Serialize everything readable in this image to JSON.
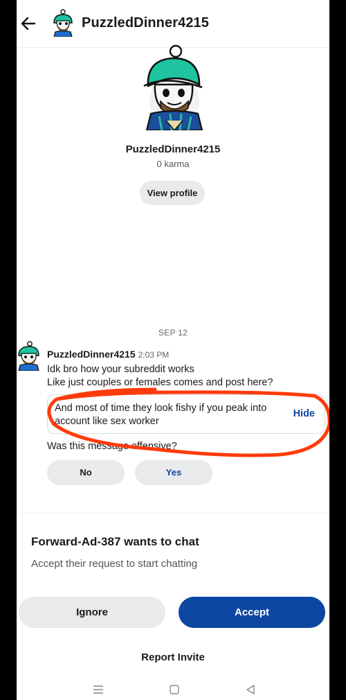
{
  "header": {
    "title": "PuzzledDinner4215"
  },
  "profile": {
    "name": "PuzzledDinner4215",
    "karma": "0 karma",
    "view_profile_label": "View profile"
  },
  "conversation": {
    "date": "SEP 12",
    "message": {
      "author": "PuzzledDinner4215",
      "time": "2:03 PM",
      "line1": "Idk bro how your subreddit works",
      "line2": "Like just couples or females comes and post here?",
      "hidden_text": "And most of time they look fishy if you peak into account like sex worker",
      "hide_label": "Hide",
      "offensive_prompt": "Was this message offensive?",
      "no_label": "No",
      "yes_label": "Yes"
    }
  },
  "chat_request": {
    "title": "Forward-Ad-387 wants to chat",
    "subtitle": "Accept their request to start chatting",
    "ignore_label": "Ignore",
    "accept_label": "Accept",
    "report_label": "Report Invite"
  },
  "colors": {
    "accent": "#0d47a1",
    "annotation": "#ff3b0a",
    "pill_bg": "#e9eaec"
  },
  "icons": [
    "back-arrow-icon",
    "recent-apps-icon",
    "home-icon",
    "back-triangle-icon"
  ]
}
